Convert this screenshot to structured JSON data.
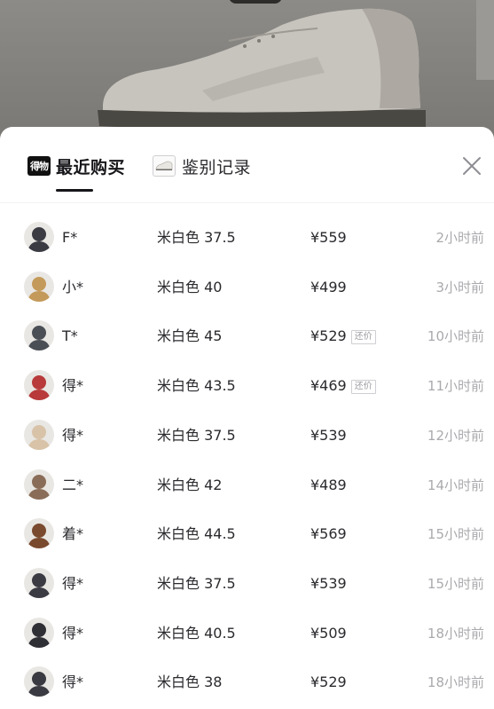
{
  "tabs": [
    {
      "label": "最近购买",
      "icon": "dewu-logo-icon",
      "icon_text": "得物",
      "active": true
    },
    {
      "label": "鉴别记录",
      "icon": "shoe-thumbnail-icon",
      "active": false
    }
  ],
  "close_icon": "close-icon",
  "haggle_badge": "还价",
  "records": [
    {
      "user": "F*",
      "spec": "米白色 37.5",
      "price": "¥559",
      "haggle": false,
      "time": "2小时前",
      "avatar_color": "#3b3b44"
    },
    {
      "user": "小*",
      "spec": "米白色 40",
      "price": "¥499",
      "haggle": false,
      "time": "3小时前",
      "avatar_color": "#c49a5a"
    },
    {
      "user": "T*",
      "spec": "米白色 45",
      "price": "¥529",
      "haggle": true,
      "time": "10小时前",
      "avatar_color": "#4a4f56"
    },
    {
      "user": "得*",
      "spec": "米白色 43.5",
      "price": "¥469",
      "haggle": true,
      "time": "11小时前",
      "avatar_color": "#b83a3a"
    },
    {
      "user": "得*",
      "spec": "米白色 37.5",
      "price": "¥539",
      "haggle": false,
      "time": "12小时前",
      "avatar_color": "#d8c3a8"
    },
    {
      "user": "二*",
      "spec": "米白色 42",
      "price": "¥489",
      "haggle": false,
      "time": "14小时前",
      "avatar_color": "#8a6d58"
    },
    {
      "user": "着*",
      "spec": "米白色 44.5",
      "price": "¥569",
      "haggle": false,
      "time": "15小时前",
      "avatar_color": "#7a4a2e"
    },
    {
      "user": "得*",
      "spec": "米白色 37.5",
      "price": "¥539",
      "haggle": false,
      "time": "15小时前",
      "avatar_color": "#3b3b44"
    },
    {
      "user": "得*",
      "spec": "米白色 40.5",
      "price": "¥509",
      "haggle": false,
      "time": "18小时前",
      "avatar_color": "#2f2f36"
    },
    {
      "user": "得*",
      "spec": "米白色 38",
      "price": "¥529",
      "haggle": false,
      "time": "18小时前",
      "avatar_color": "#3a3a42"
    }
  ]
}
